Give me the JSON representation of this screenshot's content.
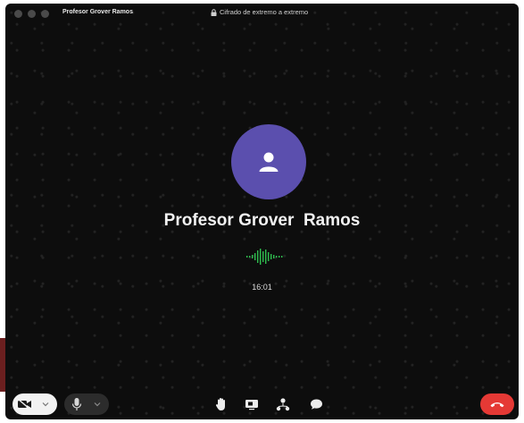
{
  "titlebar": {
    "contact_name": "Profesor Grover  Ramos",
    "encryption_text": "Cifrado de extremo a extremo"
  },
  "call": {
    "caller_name": "Profesor Grover  Ramos",
    "duration": "16:01",
    "avatar_icon": "user-icon",
    "avatar_color": "#5b4fae",
    "audio_wave_color": "#2fbf4f"
  },
  "controls": {
    "video_icon": "video-icon",
    "mic_icon": "microphone-icon",
    "raise_hand_icon": "raise-hand-icon",
    "screen_share_icon": "screen-share-icon",
    "add_participant_icon": "add-participant-icon",
    "chat_icon": "chat-icon",
    "end_call_icon": "end-call-icon",
    "end_call_color": "#e53935"
  }
}
